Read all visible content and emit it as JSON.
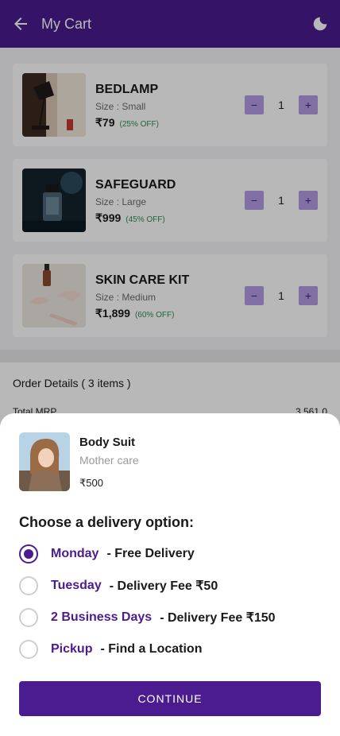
{
  "header": {
    "title": "My Cart"
  },
  "cart": {
    "items": [
      {
        "name": "BEDLAMP",
        "size": "Size : Small",
        "price": "₹79",
        "discount": "(25% OFF)",
        "qty": "1"
      },
      {
        "name": "SAFEGUARD",
        "size": "Size : Large",
        "price": "₹999",
        "discount": "(45% OFF)",
        "qty": "1"
      },
      {
        "name": "SKIN CARE KIT",
        "size": "Size : Medium",
        "price": "₹1,899",
        "discount": "(60% OFF)",
        "qty": "1"
      }
    ],
    "minus_symbol": "−",
    "plus_symbol": "+"
  },
  "order": {
    "heading": "Order Details ( 3 items )",
    "total_mrp_label": "Total MRP",
    "total_mrp_value": "3,561.0"
  },
  "sheet": {
    "product": {
      "name": "Body Suit",
      "brand": "Mother care",
      "price": "₹500"
    },
    "choose_label": "Choose a delivery option:",
    "options": [
      {
        "day": "Monday",
        "fee": "- Free Delivery",
        "selected": true
      },
      {
        "day": "Tuesday",
        "fee": "- Delivery Fee ₹50",
        "selected": false
      },
      {
        "day": "2 Business Days",
        "fee": "- Delivery Fee ₹150",
        "selected": false
      },
      {
        "day": "Pickup",
        "fee": "- Find a Location",
        "selected": false
      }
    ],
    "continue_label": "CONTINUE"
  },
  "colors": {
    "primary": "#4a1c8f",
    "qty_button": "#b49ce4",
    "discount": "#2e8b57"
  }
}
